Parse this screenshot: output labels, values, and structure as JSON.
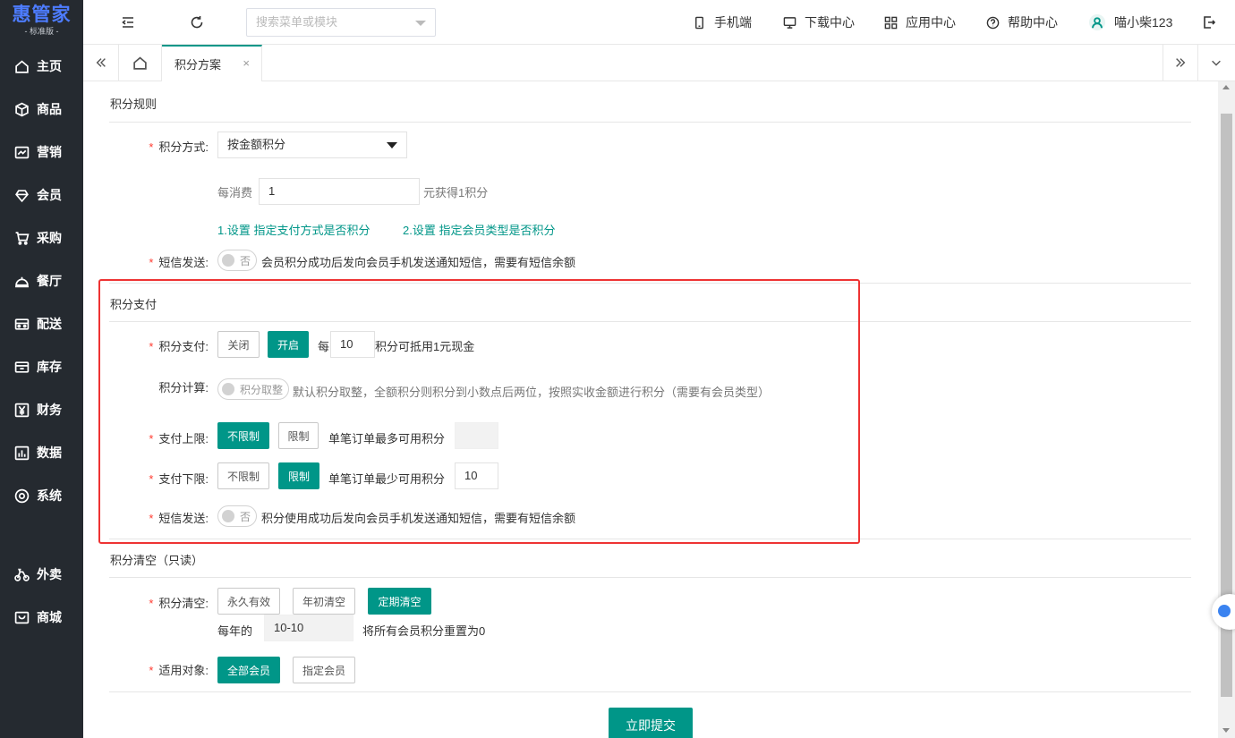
{
  "app": {
    "logo_main": "惠管家",
    "logo_sub": "- 标准版 -"
  },
  "sidebar": {
    "items": [
      {
        "label": "主页",
        "icon": "home-icon"
      },
      {
        "label": "商品",
        "icon": "cube-icon"
      },
      {
        "label": "营销",
        "icon": "chart-line-icon"
      },
      {
        "label": "会员",
        "icon": "diamond-icon"
      },
      {
        "label": "采购",
        "icon": "cart-icon"
      },
      {
        "label": "餐厅",
        "icon": "cloche-icon"
      },
      {
        "label": "配送",
        "icon": "truck-icon"
      },
      {
        "label": "库存",
        "icon": "box-icon"
      },
      {
        "label": "财务",
        "icon": "yen-icon"
      },
      {
        "label": "数据",
        "icon": "bar-chart-icon"
      },
      {
        "label": "系统",
        "icon": "settings-icon"
      },
      {
        "label": "外卖",
        "icon": "bike-icon"
      },
      {
        "label": "商城",
        "icon": "shop-icon"
      }
    ]
  },
  "header": {
    "search_placeholder": "搜索菜单或模块",
    "links": {
      "mobile": "手机端",
      "download": "下载中心",
      "apps": "应用中心",
      "help": "帮助中心",
      "user": "喵小柴123"
    }
  },
  "tabs": {
    "active": "积分方案",
    "close": "×"
  },
  "rules": {
    "title": "积分规则",
    "method_label": "积分方式:",
    "method_value": "按金额积分",
    "per_spend_label": "每消费",
    "per_spend_value": "1",
    "per_spend_suffix": "元获得1积分",
    "link1": "1.设置 指定支付方式是否积分",
    "link2": "2.设置 指定会员类型是否积分",
    "sms_label": "短信发送:",
    "sms_switch": "否",
    "sms_desc": "会员积分成功后发向会员手机发送通知短信，需要有短信余额"
  },
  "payment": {
    "title": "积分支付",
    "pay_label": "积分支付:",
    "off": "关闭",
    "on": "开启",
    "per": "每",
    "per_value": "10",
    "per_suffix": "积分可抵用1元现金",
    "calc_label": "积分计算:",
    "calc_switch": "积分取整",
    "calc_desc": "默认积分取整，全额积分则积分到小数点后两位，按照实收金额进行积分（需要有会员类型）",
    "upper_label": "支付上限:",
    "upper_unlimited": "不限制",
    "upper_limited": "限制",
    "upper_desc": "单笔订单最多可用积分",
    "upper_value": "",
    "lower_label": "支付下限:",
    "lower_unlimited": "不限制",
    "lower_limited": "限制",
    "lower_desc": "单笔订单最少可用积分",
    "lower_value": "10",
    "sms_label": "短信发送:",
    "sms_switch": "否",
    "sms_desc": "积分使用成功后发向会员手机发送通知短信，需要有短信余额"
  },
  "clear": {
    "title": "积分清空（只读）",
    "clear_label": "积分清空:",
    "opt1": "永久有效",
    "opt2": "年初清空",
    "opt3": "定期清空",
    "yearly": "每年的",
    "date_value": "10-10",
    "reset_desc": "将所有会员积分重置为0",
    "target_label": "适用对象:",
    "target_all": "全部会员",
    "target_specific": "指定会员"
  },
  "submit": "立即提交",
  "required_mark": "*",
  "colors": {
    "accent": "#009688",
    "sidebar_bg": "#252a30",
    "highlight_border": "#ee3333",
    "logo": "#4d7cff"
  }
}
